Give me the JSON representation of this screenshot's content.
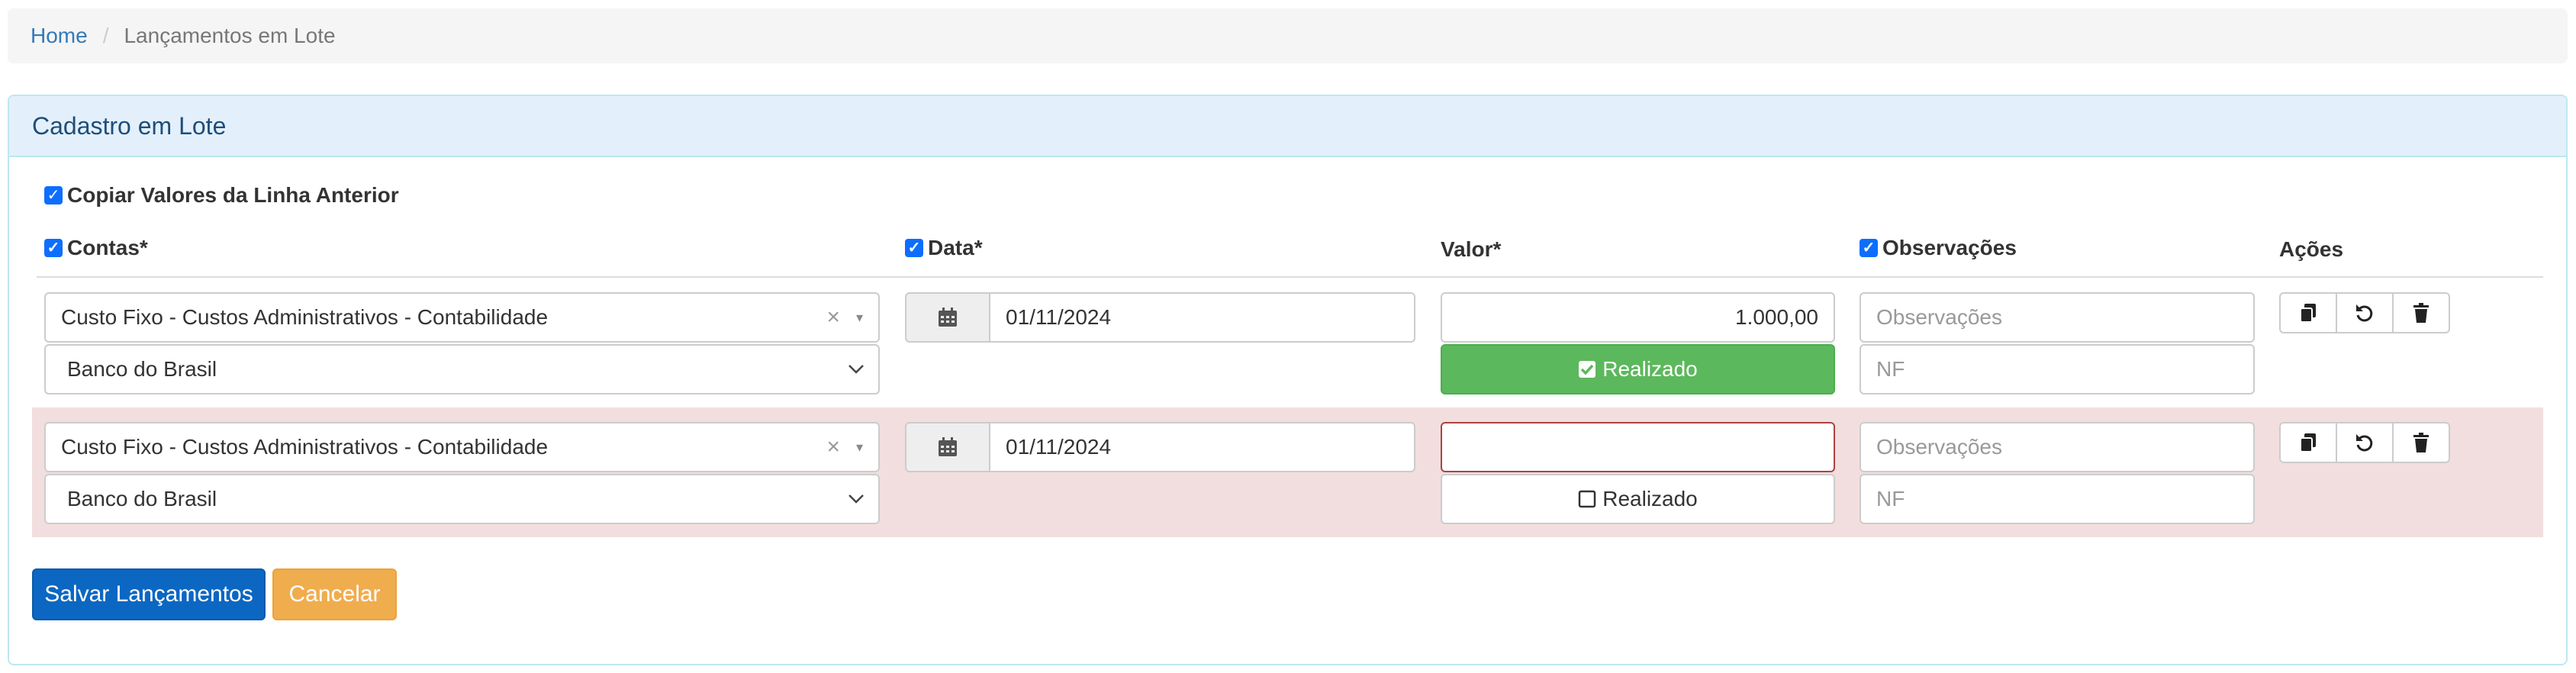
{
  "breadcrumb": {
    "home": "Home",
    "separator": "/",
    "current": "Lançamentos em Lote"
  },
  "panel": {
    "title": "Cadastro em Lote"
  },
  "copy_previous": {
    "label": "Copiar Valores da Linha Anterior",
    "checked": true
  },
  "columns": {
    "contas": {
      "label": "Contas*",
      "checked": true
    },
    "data": {
      "label": "Data*",
      "checked": true
    },
    "valor": {
      "label": "Valor*"
    },
    "observacoes": {
      "label": "Observações",
      "checked": true
    },
    "acoes": {
      "label": "Ações"
    }
  },
  "rows": [
    {
      "conta": "Custo Fixo - Custos Administrativos - Contabilidade",
      "banco": "Banco do Brasil",
      "data": "01/11/2024",
      "valor": "1.000,00",
      "realizado_label": "Realizado",
      "realizado": true,
      "observacoes_placeholder": "Observações",
      "nf_placeholder": "NF"
    },
    {
      "conta": "Custo Fixo - Custos Administrativos - Contabilidade",
      "banco": "Banco do Brasil",
      "data": "01/11/2024",
      "valor": "",
      "realizado_label": "Realizado",
      "realizado": false,
      "observacoes_placeholder": "Observações",
      "nf_placeholder": "NF"
    }
  ],
  "buttons": {
    "save": "Salvar Lançamentos",
    "cancel": "Cancelar"
  },
  "icons": {
    "clear": "×",
    "caret": "▾",
    "chevron": "⌄",
    "check": "✓"
  },
  "colors": {
    "primary": "#0b67c2",
    "success": "#5cb85c",
    "warning": "#f0ad4e",
    "error_bg": "#f2dede",
    "error_border": "#a94442"
  }
}
